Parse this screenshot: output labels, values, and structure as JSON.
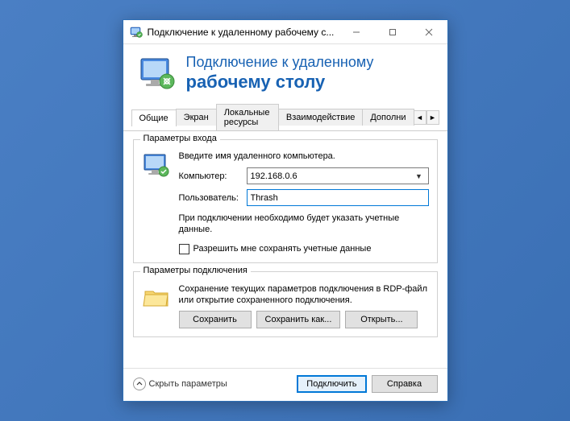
{
  "window": {
    "title": "Подключение к удаленному рабочему с..."
  },
  "header": {
    "line1": "Подключение к удаленному",
    "line2": "рабочему столу"
  },
  "tabs": {
    "items": [
      {
        "label": "Общие",
        "active": true
      },
      {
        "label": "Экран"
      },
      {
        "label": "Локальные ресурсы"
      },
      {
        "label": "Взаимодействие"
      },
      {
        "label": "Дополни"
      }
    ]
  },
  "login_group": {
    "title": "Параметры входа",
    "instruction": "Введите имя удаленного компьютера.",
    "computer_label": "Компьютер:",
    "computer_value": "192.168.0.6",
    "user_label": "Пользователь:",
    "user_value": "Thrash",
    "note": "При подключении необходимо будет указать учетные данные.",
    "checkbox_label": "Разрешить мне сохранять учетные данные"
  },
  "conn_group": {
    "title": "Параметры подключения",
    "description": "Сохранение текущих параметров подключения в RDP-файл или открытие сохраненного подключения.",
    "save_label": "Сохранить",
    "save_as_label": "Сохранить как...",
    "open_label": "Открыть..."
  },
  "footer": {
    "hide_label": "Скрыть параметры",
    "connect_label": "Подключить",
    "help_label": "Справка"
  }
}
